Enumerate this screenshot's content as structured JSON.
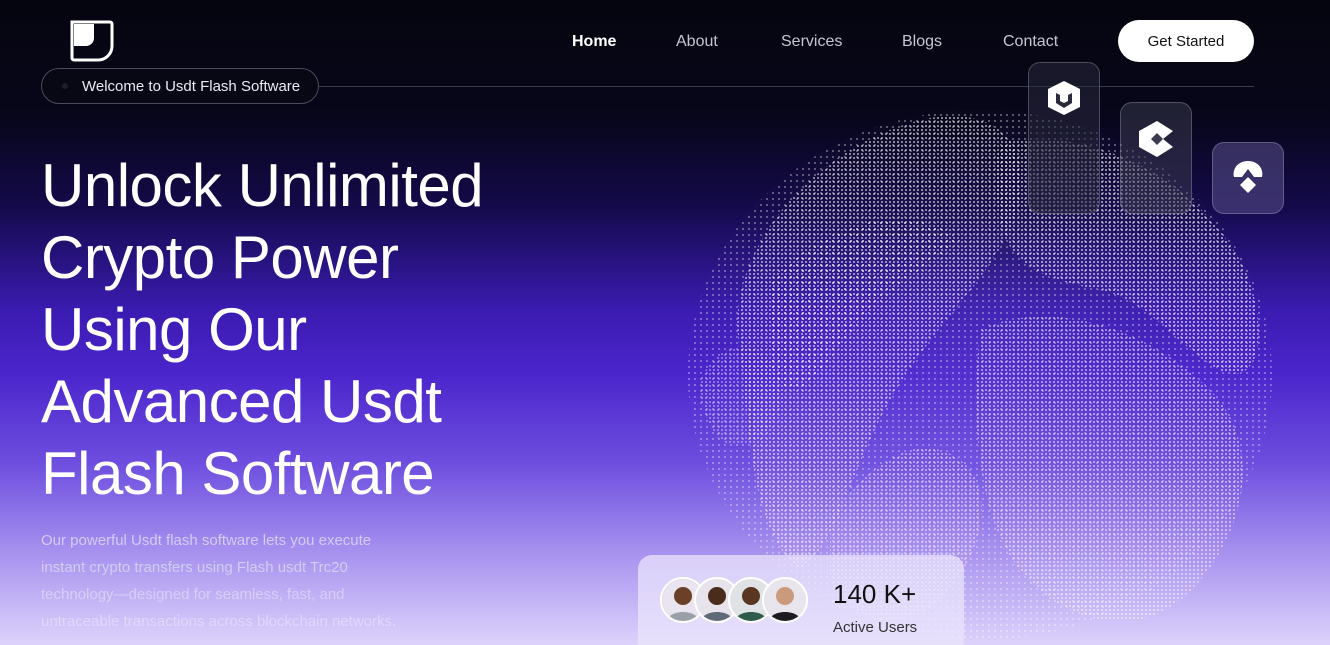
{
  "brand": {
    "logo_icon": "brand-logo-icon"
  },
  "nav": {
    "items": [
      {
        "label": "Home",
        "active": true
      },
      {
        "label": "About",
        "active": false
      },
      {
        "label": "Services",
        "active": false
      },
      {
        "label": "Blogs",
        "active": false
      },
      {
        "label": "Contact",
        "active": false
      }
    ],
    "cta_label": "Get Started"
  },
  "hero": {
    "badge": "Welcome to Usdt Flash Software",
    "headline_lines": [
      "Unlock Unlimited",
      "Crypto Power",
      "Using Our",
      "Advanced Usdt",
      "Flash Software"
    ],
    "description_lines": [
      "Our powerful Usdt flash software lets you execute",
      "instant crypto transfers using Flash usdt Trc20",
      "technology—designed for seamless, fast, and",
      "untraceable transactions across blockchain networks."
    ]
  },
  "app_icons": [
    "shield-box-icon",
    "c-shape-icon",
    "diamond-arrow-icon"
  ],
  "stats": {
    "count": "140 K+",
    "label": "Active Users"
  },
  "colors": {
    "background_top": "#05050f",
    "accent_purple": "#4b25cc",
    "cta_bg": "#ffffff"
  }
}
